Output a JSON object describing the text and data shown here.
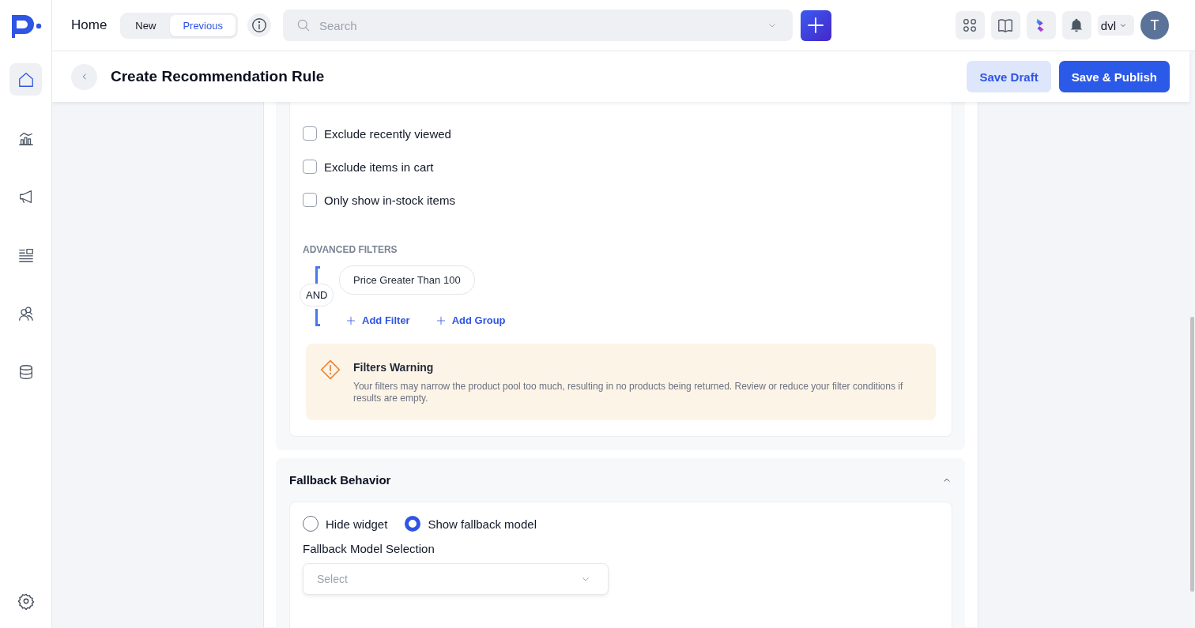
{
  "sidebar": {
    "nav_items": [
      {
        "selected": true
      },
      {
        "selected": false
      },
      {
        "selected": false
      },
      {
        "selected": false
      },
      {
        "selected": false
      },
      {
        "selected": false
      }
    ]
  },
  "topbar": {
    "title": "Home",
    "view_toggle": [
      {
        "label": "New",
        "selected": false
      },
      {
        "label": "Previous",
        "selected": true
      }
    ],
    "search": {
      "placeholder": "Search"
    },
    "workspace": "dvl",
    "avatar": "T"
  },
  "page_header": {
    "title": "Create Recommendation Rule",
    "buttons": [
      {
        "label": "Save Draft",
        "kind": "secondary"
      },
      {
        "label": "Save & Publish",
        "kind": "primary"
      }
    ]
  },
  "filters": {
    "options": [
      {
        "label": "Exclude recently viewed",
        "checked": false
      },
      {
        "label": "Exclude items in cart",
        "checked": false
      },
      {
        "label": "Only show in-stock items",
        "checked": false
      }
    ],
    "advanced_title": "ADVANCED FILTERS",
    "operator": "AND",
    "conditions": [
      "Price Greater Than 100"
    ],
    "actions": [
      "Add Filter",
      "Add Group"
    ],
    "warning": {
      "title": "Filters Warning",
      "message": "Your filters may narrow the product pool too much, resulting in no products being returned. Review or reduce your filter conditions if results are empty."
    }
  },
  "fallback": {
    "title": "Fallback Behavior",
    "expanded": true,
    "options": [
      {
        "label": "Hide widget",
        "selected": false
      },
      {
        "label": "Show fallback model",
        "selected": true
      }
    ],
    "model_label": "Fallback Model Selection",
    "model_select": {
      "placeholder": "Select"
    }
  }
}
